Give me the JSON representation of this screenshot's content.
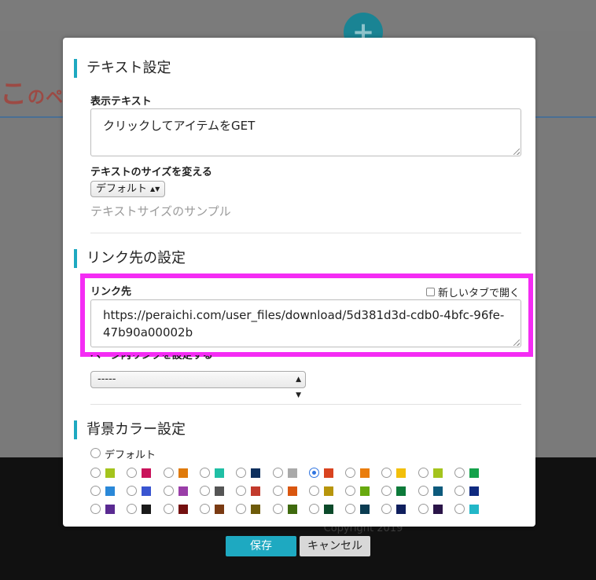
{
  "background": {
    "heading_char": "こ",
    "heading_rest": "のペ",
    "copyright": "Copyright 2019",
    "add_icon": "plus-icon"
  },
  "text_settings": {
    "title": "テキスト設定",
    "display_text_label": "表示テキスト",
    "display_text_value": "クリックしてアイテムをGET",
    "size_label": "テキストのサイズを変える",
    "size_selected": "デフォルト",
    "size_sample": "テキストサイズのサンプル"
  },
  "link_settings": {
    "title": "リンク先の設定",
    "link_label": "リンク先",
    "new_tab_label": "新しいタブで開く",
    "new_tab_checked": false,
    "link_value": "https://peraichi.com/user_files/download/5d381d3d-cdb0-4bfc-96fe-47b90a00002b",
    "anchor_label": "ページ内リンクを設定する",
    "anchor_selected": "-----"
  },
  "bg_color_settings": {
    "title": "背景カラー設定",
    "default_label": "デフォルト",
    "selected_index": 6,
    "colors": [
      "#a4c41d",
      "#c9135b",
      "#df7a0b",
      "#1fbfa5",
      "#0d2f5e",
      "#a9a9a9",
      "#d9431f",
      "#ea7d0c",
      "#f2bf0a",
      "#a4c41d",
      "#14a24b",
      "#2a88d8",
      "#3a55d1",
      "#9a3ea8",
      "#555555",
      "#c23a2c",
      "#d9560f",
      "#b7950c",
      "#67a90e",
      "#0c7a3a",
      "#0d5a7c",
      "#0f2a80",
      "#5a2a92",
      "#1a1a1a",
      "#741010",
      "#7a3a12",
      "#6e5b0a",
      "#3f6a0e",
      "#0b4a2a",
      "#0b3c52",
      "#0f1f5e",
      "#2a1448",
      "#22b7c8"
    ]
  },
  "buttons": {
    "save": "保存",
    "cancel": "キャンセル"
  }
}
